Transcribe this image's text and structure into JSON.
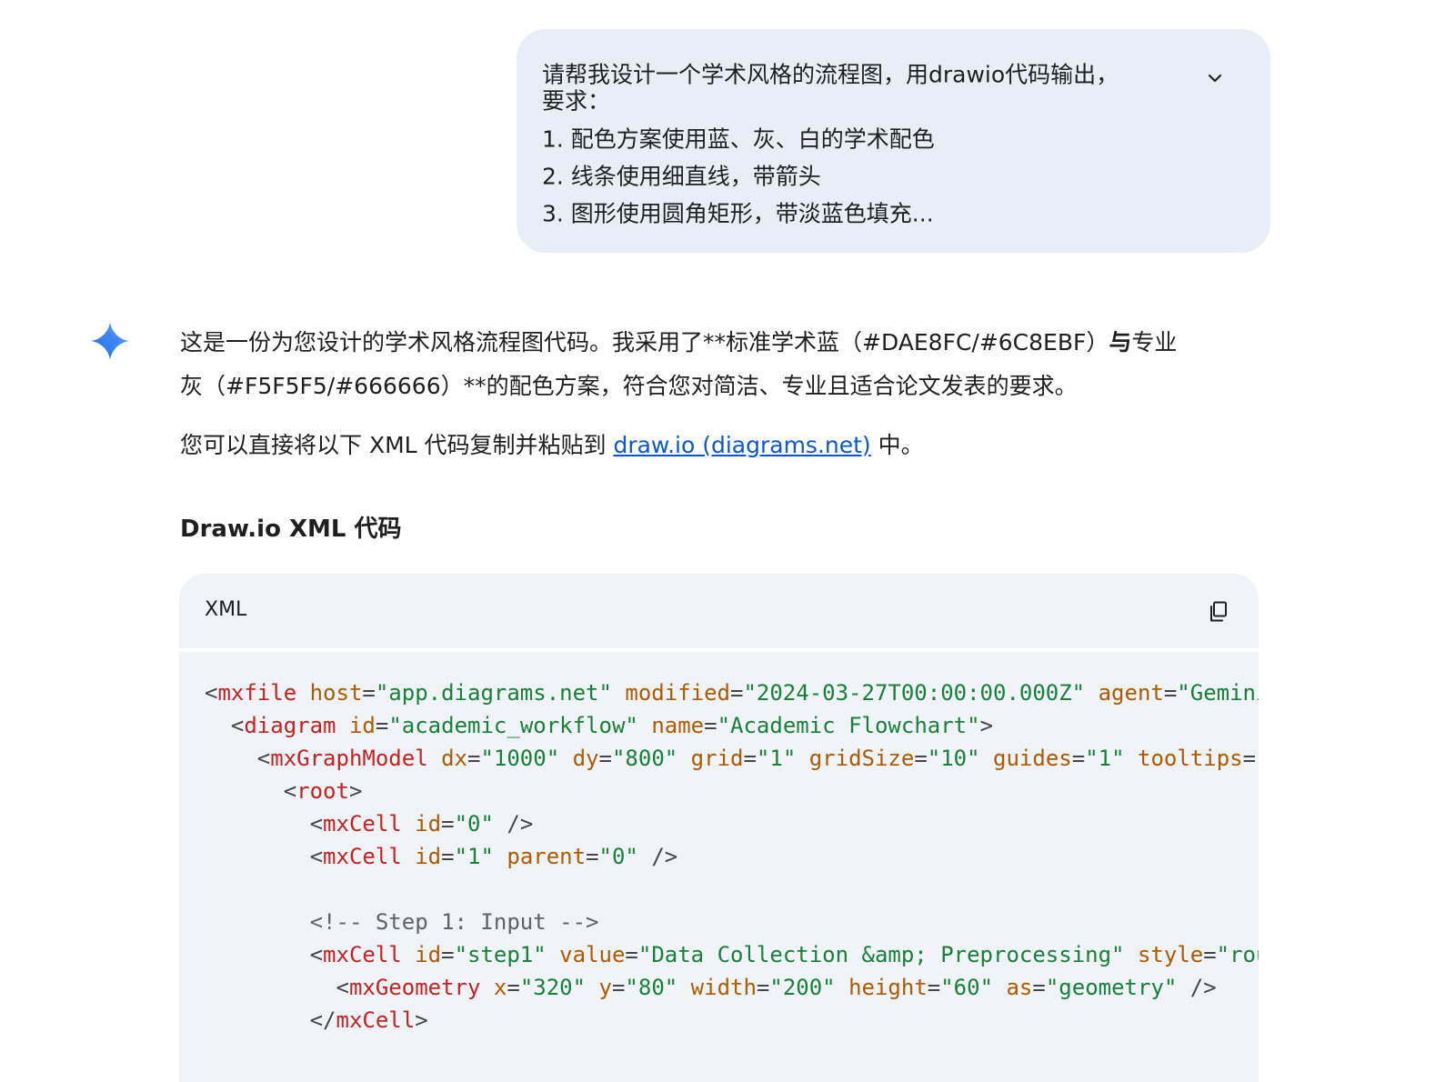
{
  "user_prompt": {
    "lines": [
      "请帮我设计一个学术风格的流程图，用drawio代码输出，",
      "要求：",
      "1. 配色方案使用蓝、灰、白的学术配色",
      "2. 线条使用细直线，带箭头",
      "3. 图形使用圆角矩形，带淡蓝色填充..."
    ],
    "expand_icon": "chevron-down-icon"
  },
  "response": {
    "assistant_icon": "gemini-sparkle-icon",
    "intro_line1_part1": "这是一份为您设计的学术风格流程图代码。我采用了**标准学术蓝（#DAE8FC/#6C8EBF）",
    "intro_line1_bold": "与",
    "intro_line1_part2": "专业",
    "intro_line2": "灰（#F5F5F5/#666666）**的配色方案，符合您对简洁、专业且适合论文发表的要求。",
    "paste_prefix": "您可以直接将以下 XML 代码复制并粘贴到 ",
    "paste_link": "draw.io (diagrams.net)",
    "paste_suffix": " 中。",
    "section_heading": "Draw.io XML 代码"
  },
  "code_block": {
    "language": "XML",
    "copy_icon": "copy-icon",
    "lines": [
      [
        [
          "<",
          "p"
        ],
        [
          "mxfile",
          "t"
        ],
        [
          " ",
          "p"
        ],
        [
          "host",
          "a"
        ],
        [
          "=",
          "p"
        ],
        [
          "\"app.diagrams.net\"",
          "v"
        ],
        [
          " ",
          "p"
        ],
        [
          "modified",
          "a"
        ],
        [
          "=",
          "p"
        ],
        [
          "\"2024-03-27T00:00:00.000Z\"",
          "v"
        ],
        [
          " ",
          "p"
        ],
        [
          "agent",
          "a"
        ],
        [
          "=",
          "p"
        ],
        [
          "\"Gemini",
          "v"
        ]
      ],
      [
        [
          "  <",
          "p"
        ],
        [
          "diagram",
          "t"
        ],
        [
          " ",
          "p"
        ],
        [
          "id",
          "a"
        ],
        [
          "=",
          "p"
        ],
        [
          "\"academic_workflow\"",
          "v"
        ],
        [
          " ",
          "p"
        ],
        [
          "name",
          "a"
        ],
        [
          "=",
          "p"
        ],
        [
          "\"Academic Flowchart\"",
          "v"
        ],
        [
          ">",
          "p"
        ]
      ],
      [
        [
          "    <",
          "p"
        ],
        [
          "mxGraphModel",
          "t"
        ],
        [
          " ",
          "p"
        ],
        [
          "dx",
          "a"
        ],
        [
          "=",
          "p"
        ],
        [
          "\"1000\"",
          "v"
        ],
        [
          " ",
          "p"
        ],
        [
          "dy",
          "a"
        ],
        [
          "=",
          "p"
        ],
        [
          "\"800\"",
          "v"
        ],
        [
          " ",
          "p"
        ],
        [
          "grid",
          "a"
        ],
        [
          "=",
          "p"
        ],
        [
          "\"1\"",
          "v"
        ],
        [
          " ",
          "p"
        ],
        [
          "gridSize",
          "a"
        ],
        [
          "=",
          "p"
        ],
        [
          "\"10\"",
          "v"
        ],
        [
          " ",
          "p"
        ],
        [
          "guides",
          "a"
        ],
        [
          "=",
          "p"
        ],
        [
          "\"1\"",
          "v"
        ],
        [
          " ",
          "p"
        ],
        [
          "tooltips",
          "a"
        ],
        [
          "=\"",
          "p"
        ]
      ],
      [
        [
          "      <",
          "p"
        ],
        [
          "root",
          "t"
        ],
        [
          ">",
          "p"
        ]
      ],
      [
        [
          "        <",
          "p"
        ],
        [
          "mxCell",
          "t"
        ],
        [
          " ",
          "p"
        ],
        [
          "id",
          "a"
        ],
        [
          "=",
          "p"
        ],
        [
          "\"0\"",
          "v"
        ],
        [
          " />",
          "p"
        ]
      ],
      [
        [
          "        <",
          "p"
        ],
        [
          "mxCell",
          "t"
        ],
        [
          " ",
          "p"
        ],
        [
          "id",
          "a"
        ],
        [
          "=",
          "p"
        ],
        [
          "\"1\"",
          "v"
        ],
        [
          " ",
          "p"
        ],
        [
          "parent",
          "a"
        ],
        [
          "=",
          "p"
        ],
        [
          "\"0\"",
          "v"
        ],
        [
          " />",
          "p"
        ]
      ],
      [
        [
          "",
          "p"
        ]
      ],
      [
        [
          "        <!-- Step 1: Input -->",
          "c"
        ]
      ],
      [
        [
          "        <",
          "p"
        ],
        [
          "mxCell",
          "t"
        ],
        [
          " ",
          "p"
        ],
        [
          "id",
          "a"
        ],
        [
          "=",
          "p"
        ],
        [
          "\"step1\"",
          "v"
        ],
        [
          " ",
          "p"
        ],
        [
          "value",
          "a"
        ],
        [
          "=",
          "p"
        ],
        [
          "\"Data Collection &amp; Preprocessing\"",
          "v"
        ],
        [
          " ",
          "p"
        ],
        [
          "style",
          "a"
        ],
        [
          "=",
          "p"
        ],
        [
          "\"rou",
          "v"
        ]
      ],
      [
        [
          "          <",
          "p"
        ],
        [
          "mxGeometry",
          "t"
        ],
        [
          " ",
          "p"
        ],
        [
          "x",
          "a"
        ],
        [
          "=",
          "p"
        ],
        [
          "\"320\"",
          "v"
        ],
        [
          " ",
          "p"
        ],
        [
          "y",
          "a"
        ],
        [
          "=",
          "p"
        ],
        [
          "\"80\"",
          "v"
        ],
        [
          " ",
          "p"
        ],
        [
          "width",
          "a"
        ],
        [
          "=",
          "p"
        ],
        [
          "\"200\"",
          "v"
        ],
        [
          " ",
          "p"
        ],
        [
          "height",
          "a"
        ],
        [
          "=",
          "p"
        ],
        [
          "\"60\"",
          "v"
        ],
        [
          " ",
          "p"
        ],
        [
          "as",
          "a"
        ],
        [
          "=",
          "p"
        ],
        [
          "\"geometry\"",
          "v"
        ],
        [
          " />",
          "p"
        ]
      ],
      [
        [
          "        </",
          "p"
        ],
        [
          "mxCell",
          "t"
        ],
        [
          ">",
          "p"
        ]
      ]
    ]
  },
  "colors": {
    "bubble_bg": "#e9eef6",
    "code_bg": "#f0f4f9",
    "link": "#0b57d0",
    "tag": "#c5221f",
    "attr": "#b05a00",
    "value": "#188038"
  }
}
